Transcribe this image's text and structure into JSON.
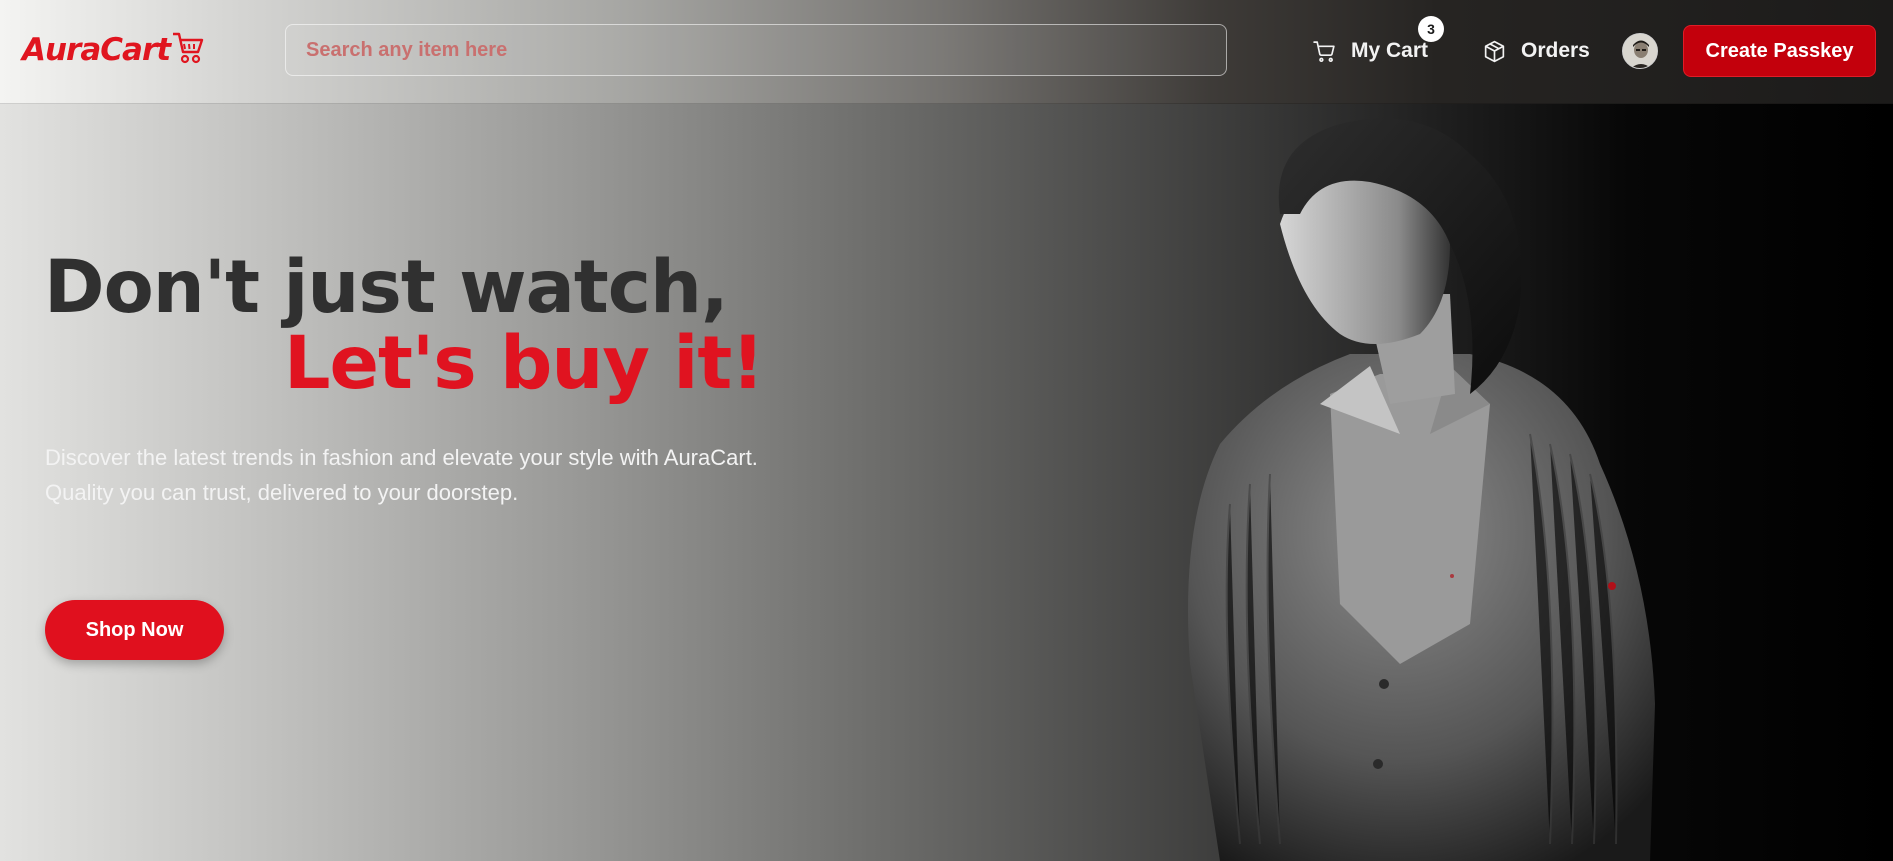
{
  "header": {
    "logo_text": "AuraCart",
    "search_placeholder": "Search any item here",
    "cart_label": "My Cart",
    "cart_count": "3",
    "orders_label": "Orders",
    "passkey_label": "Create Passkey"
  },
  "hero": {
    "headline_line1": "Don't just watch,",
    "headline_line2": "Let's buy it!",
    "description_line1": "Discover the latest trends in fashion and elevate your style with AuraCart.",
    "description_line2": "Quality you can trust, delivered to your doorstep.",
    "cta_label": "Shop Now"
  },
  "colors": {
    "brand_red": "#e0151f",
    "passkey_red": "#c3000c",
    "headline_dark": "#303030"
  },
  "icons": [
    "cart-icon",
    "package-icon",
    "logo-cart-icon"
  ]
}
